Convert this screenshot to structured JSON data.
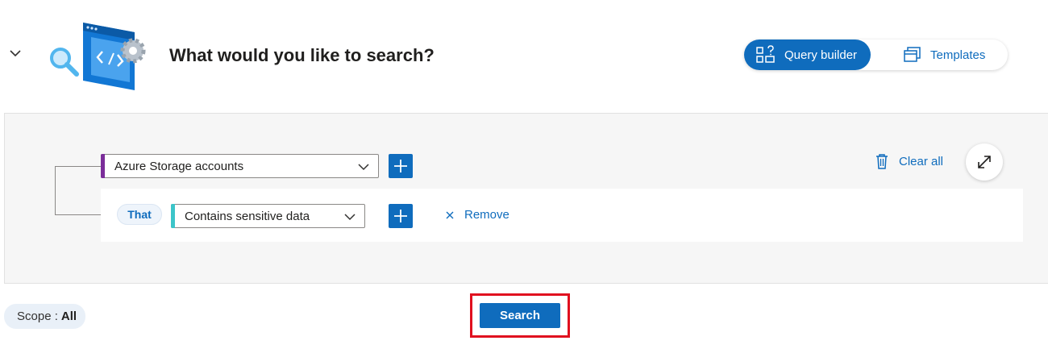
{
  "header": {
    "title": "What would you like to search?",
    "collapse_icon": "chevron-down-icon",
    "illustration": "search-code-illustration"
  },
  "view_toggle": {
    "query_builder_label": "Query builder",
    "query_builder_icon": "query-builder-icon",
    "templates_label": "Templates",
    "templates_icon": "templates-icon",
    "selected": "Query builder"
  },
  "builder": {
    "resource_select": {
      "value": "Azure Storage accounts",
      "accent_color": "#7b2d9a"
    },
    "condition": {
      "connector": "That",
      "select_value": "Contains sensitive data",
      "accent_color": "#3cc5c9",
      "remove_label": "Remove"
    },
    "clear_all_label": "Clear all",
    "expand_icon": "expand-icon"
  },
  "footer": {
    "scope_label": "Scope :",
    "scope_value": "All",
    "search_label": "Search"
  },
  "colors": {
    "accent": "#0f6cbd",
    "highlight": "#e0101f"
  }
}
